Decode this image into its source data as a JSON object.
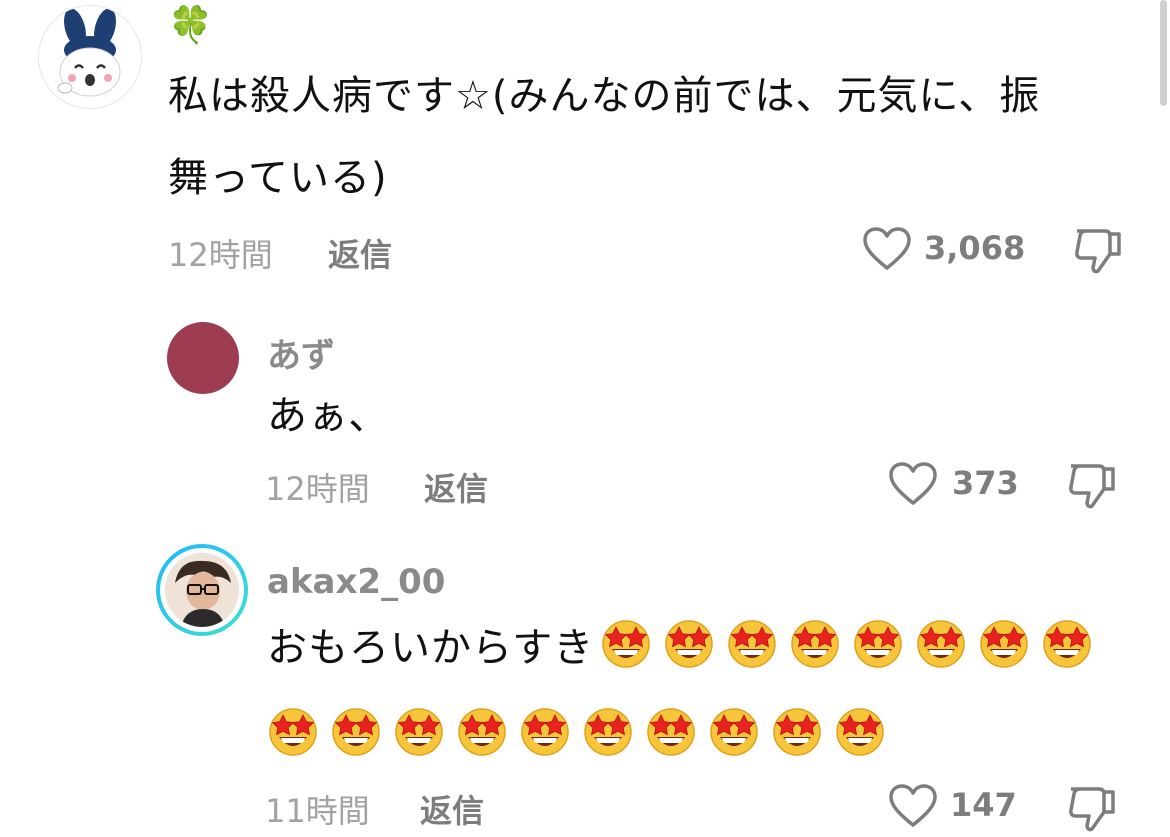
{
  "comments": [
    {
      "username": "🍀",
      "text_line1": "私は殺人病です☆(みんなの前では、元気に、振",
      "text_line2": "舞っている)",
      "time": "12時間",
      "reply_label": "返信",
      "likes": "3,068"
    },
    {
      "username": "あず",
      "text_line1": "あぁ、",
      "time": "12時間",
      "reply_label": "返信",
      "likes": "373"
    },
    {
      "username": "akax2_00",
      "text_line1": "おもろいからすき",
      "emoji_count_line1": 8,
      "emoji_count_line2": 10,
      "time": "11時間",
      "reply_label": "返信",
      "likes": "147"
    }
  ],
  "icons": {
    "like": "heart-outline-icon",
    "dislike": "thumbs-down-outline-icon",
    "emoji": "star-struck-emoji"
  },
  "colors": {
    "username": "#8a8a8a",
    "meta": "#a2a2a2",
    "action": "#7d7d7d",
    "avatar_maroon": "#9e3c52",
    "story_ring_start": "#1fb7ff",
    "story_ring_end": "#3fe0cf"
  }
}
